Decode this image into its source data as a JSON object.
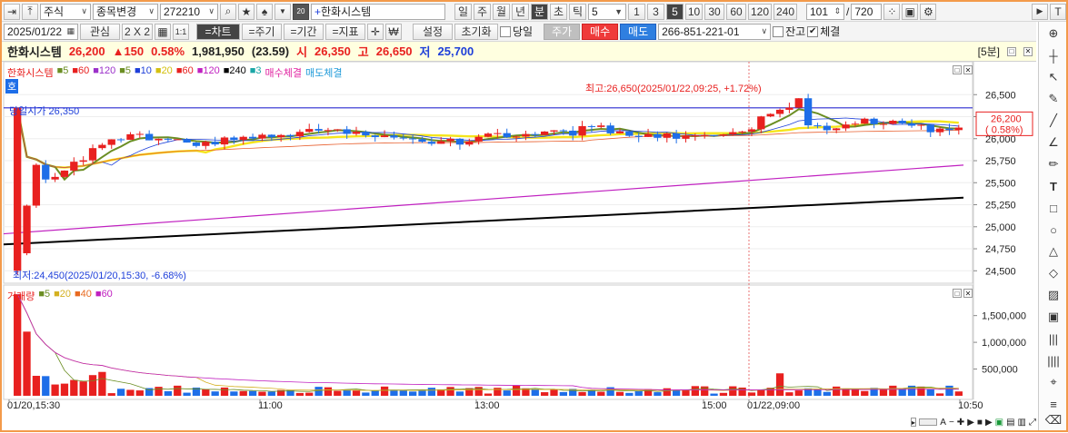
{
  "toolbar": {
    "market_select": "주식",
    "symbol_change": "종목변경",
    "code": "272210",
    "stock_name": "한화시스템",
    "periods": [
      "일",
      "주",
      "월",
      "년",
      "분",
      "초",
      "틱"
    ],
    "interval_value": "5",
    "minute_options": [
      "1",
      "3",
      "5",
      "10",
      "30",
      "60",
      "120",
      "240"
    ],
    "count_value": "101",
    "count_total": "720",
    "date_value": "2025/01/22",
    "watch_label": "관심",
    "grid_label": "2 X 2",
    "ratio_label": "1:1",
    "chart_tab": "=차트",
    "period_tab": "=주기",
    "range_tab": "=기간",
    "indicator_tab": "=지표",
    "won_symbol": "₩",
    "settings_label": "설정",
    "reset_label": "초기화",
    "today_label": "당일",
    "order_label": "주가",
    "buy_label": "매수",
    "sell_label": "매도",
    "account_value": "266-851-221-01",
    "balance_label": "잔고",
    "fill_label": "체결",
    "small_label": "T"
  },
  "info": {
    "name": "한화시스템",
    "price": "26,200",
    "change": "▲150",
    "change_pct": "0.58%",
    "volume_text": "1,981,950",
    "volume_pct": "(23.59)",
    "open_label": "시",
    "open": "26,350",
    "high_label": "고",
    "high": "26,650",
    "low_label": "저",
    "low": "25,700",
    "interval_tag": "[5분]"
  },
  "price_panel": {
    "legend_name": "한화시스템",
    "ma_legend": [
      {
        "label": "5",
        "color": "#6b8e23"
      },
      {
        "label": "60",
        "color": "#e8201f"
      },
      {
        "label": "120",
        "color": "#9b30c9"
      },
      {
        "label": "5",
        "color": "#6b8e23"
      },
      {
        "label": "10",
        "color": "#1e3fd9"
      },
      {
        "label": "20",
        "color": "#f5e51b"
      },
      {
        "label": "60",
        "color": "#e8201f"
      },
      {
        "label": "120",
        "color": "#c020c0"
      },
      {
        "label": "240",
        "color": "#000000"
      },
      {
        "label": "3",
        "color": "#1aa6a6"
      }
    ],
    "buy_fill_legend": "매수체결",
    "sell_fill_legend": "매도체결",
    "hoga_tag": "호",
    "prev_open_label": "당일시가 26,350",
    "high_annotation": "최고:26,650(2025/01/22,09:25, +1.72%)",
    "low_annotation": "최저:24,450(2025/01/20,15:30, -6.68%)",
    "price_ticks": [
      "26,500",
      "26,250",
      "26,000",
      "25,750",
      "25,500",
      "25,250",
      "25,000",
      "24,750",
      "24,500"
    ],
    "current_price_tag": "26,200",
    "current_pct_tag": "( 0.58%)"
  },
  "volume_panel": {
    "title": "거래량",
    "ma_legend": [
      {
        "label": "5",
        "color": "#6b8e23"
      },
      {
        "label": "20",
        "color": "#d4b020"
      },
      {
        "label": "40",
        "color": "#e86a20"
      },
      {
        "label": "60",
        "color": "#c020c0"
      }
    ],
    "volume_ticks": [
      "1,500,000",
      "1,000,000",
      "500,000"
    ]
  },
  "time_axis": [
    "01/20,15:30",
    "11:00",
    "13:00",
    "15:00",
    "01/22,09:00",
    "10:50"
  ],
  "chart_data": {
    "type": "candlestick",
    "price_ylim": [
      24400,
      26750
    ],
    "volume_ylim": [
      0,
      1800000
    ],
    "series_colors": {
      "up": "#e8201f",
      "down": "#1e6ee8"
    },
    "prev_open": 26350,
    "high": 26650,
    "low": 24450
  },
  "colors": {
    "up": "#e8201f",
    "down": "#1e6ee8",
    "ma5": "#6b8e23",
    "ma20": "#f5e51b",
    "ma60": "#e8602f",
    "ma120": "#c020c0",
    "ma240": "#000000",
    "accent": "#f39a4a"
  }
}
